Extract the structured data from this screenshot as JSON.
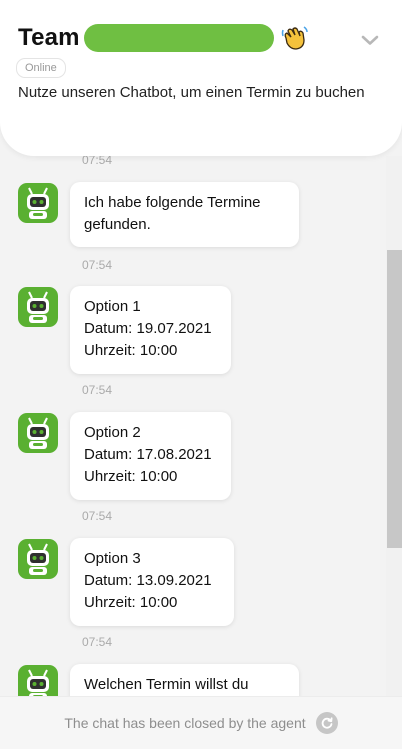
{
  "header": {
    "title": "Team",
    "status": "Online",
    "subtitle": "Nutze unseren Chatbot, um einen Termin zu buchen"
  },
  "messages": [
    {
      "time": "07:54"
    },
    {
      "text": "Ich habe folgende Termine gefunden.",
      "time": "07:54"
    },
    {
      "lines": [
        "Option 1",
        "Datum: 19.07.2021",
        "Uhrzeit: 10:00"
      ],
      "time": "07:54"
    },
    {
      "lines": [
        "Option 2",
        "Datum: 17.08.2021",
        "Uhrzeit: 10:00"
      ],
      "time": "07:54"
    },
    {
      "lines": [
        "Option 3",
        "Datum: 13.09.2021",
        "Uhrzeit: 10:00"
      ],
      "time": "07:54"
    },
    {
      "text": "Welchen Termin willst du"
    }
  ],
  "footer": {
    "closed_text": "The chat has been closed by the agent"
  },
  "colors": {
    "brand_green": "#6fbf42",
    "avatar_green": "#5ab031"
  },
  "icons": {
    "wave": "waving-hand-icon",
    "collapse": "chevron-down-icon",
    "bot": "robot-avatar-icon",
    "refresh": "refresh-icon"
  }
}
